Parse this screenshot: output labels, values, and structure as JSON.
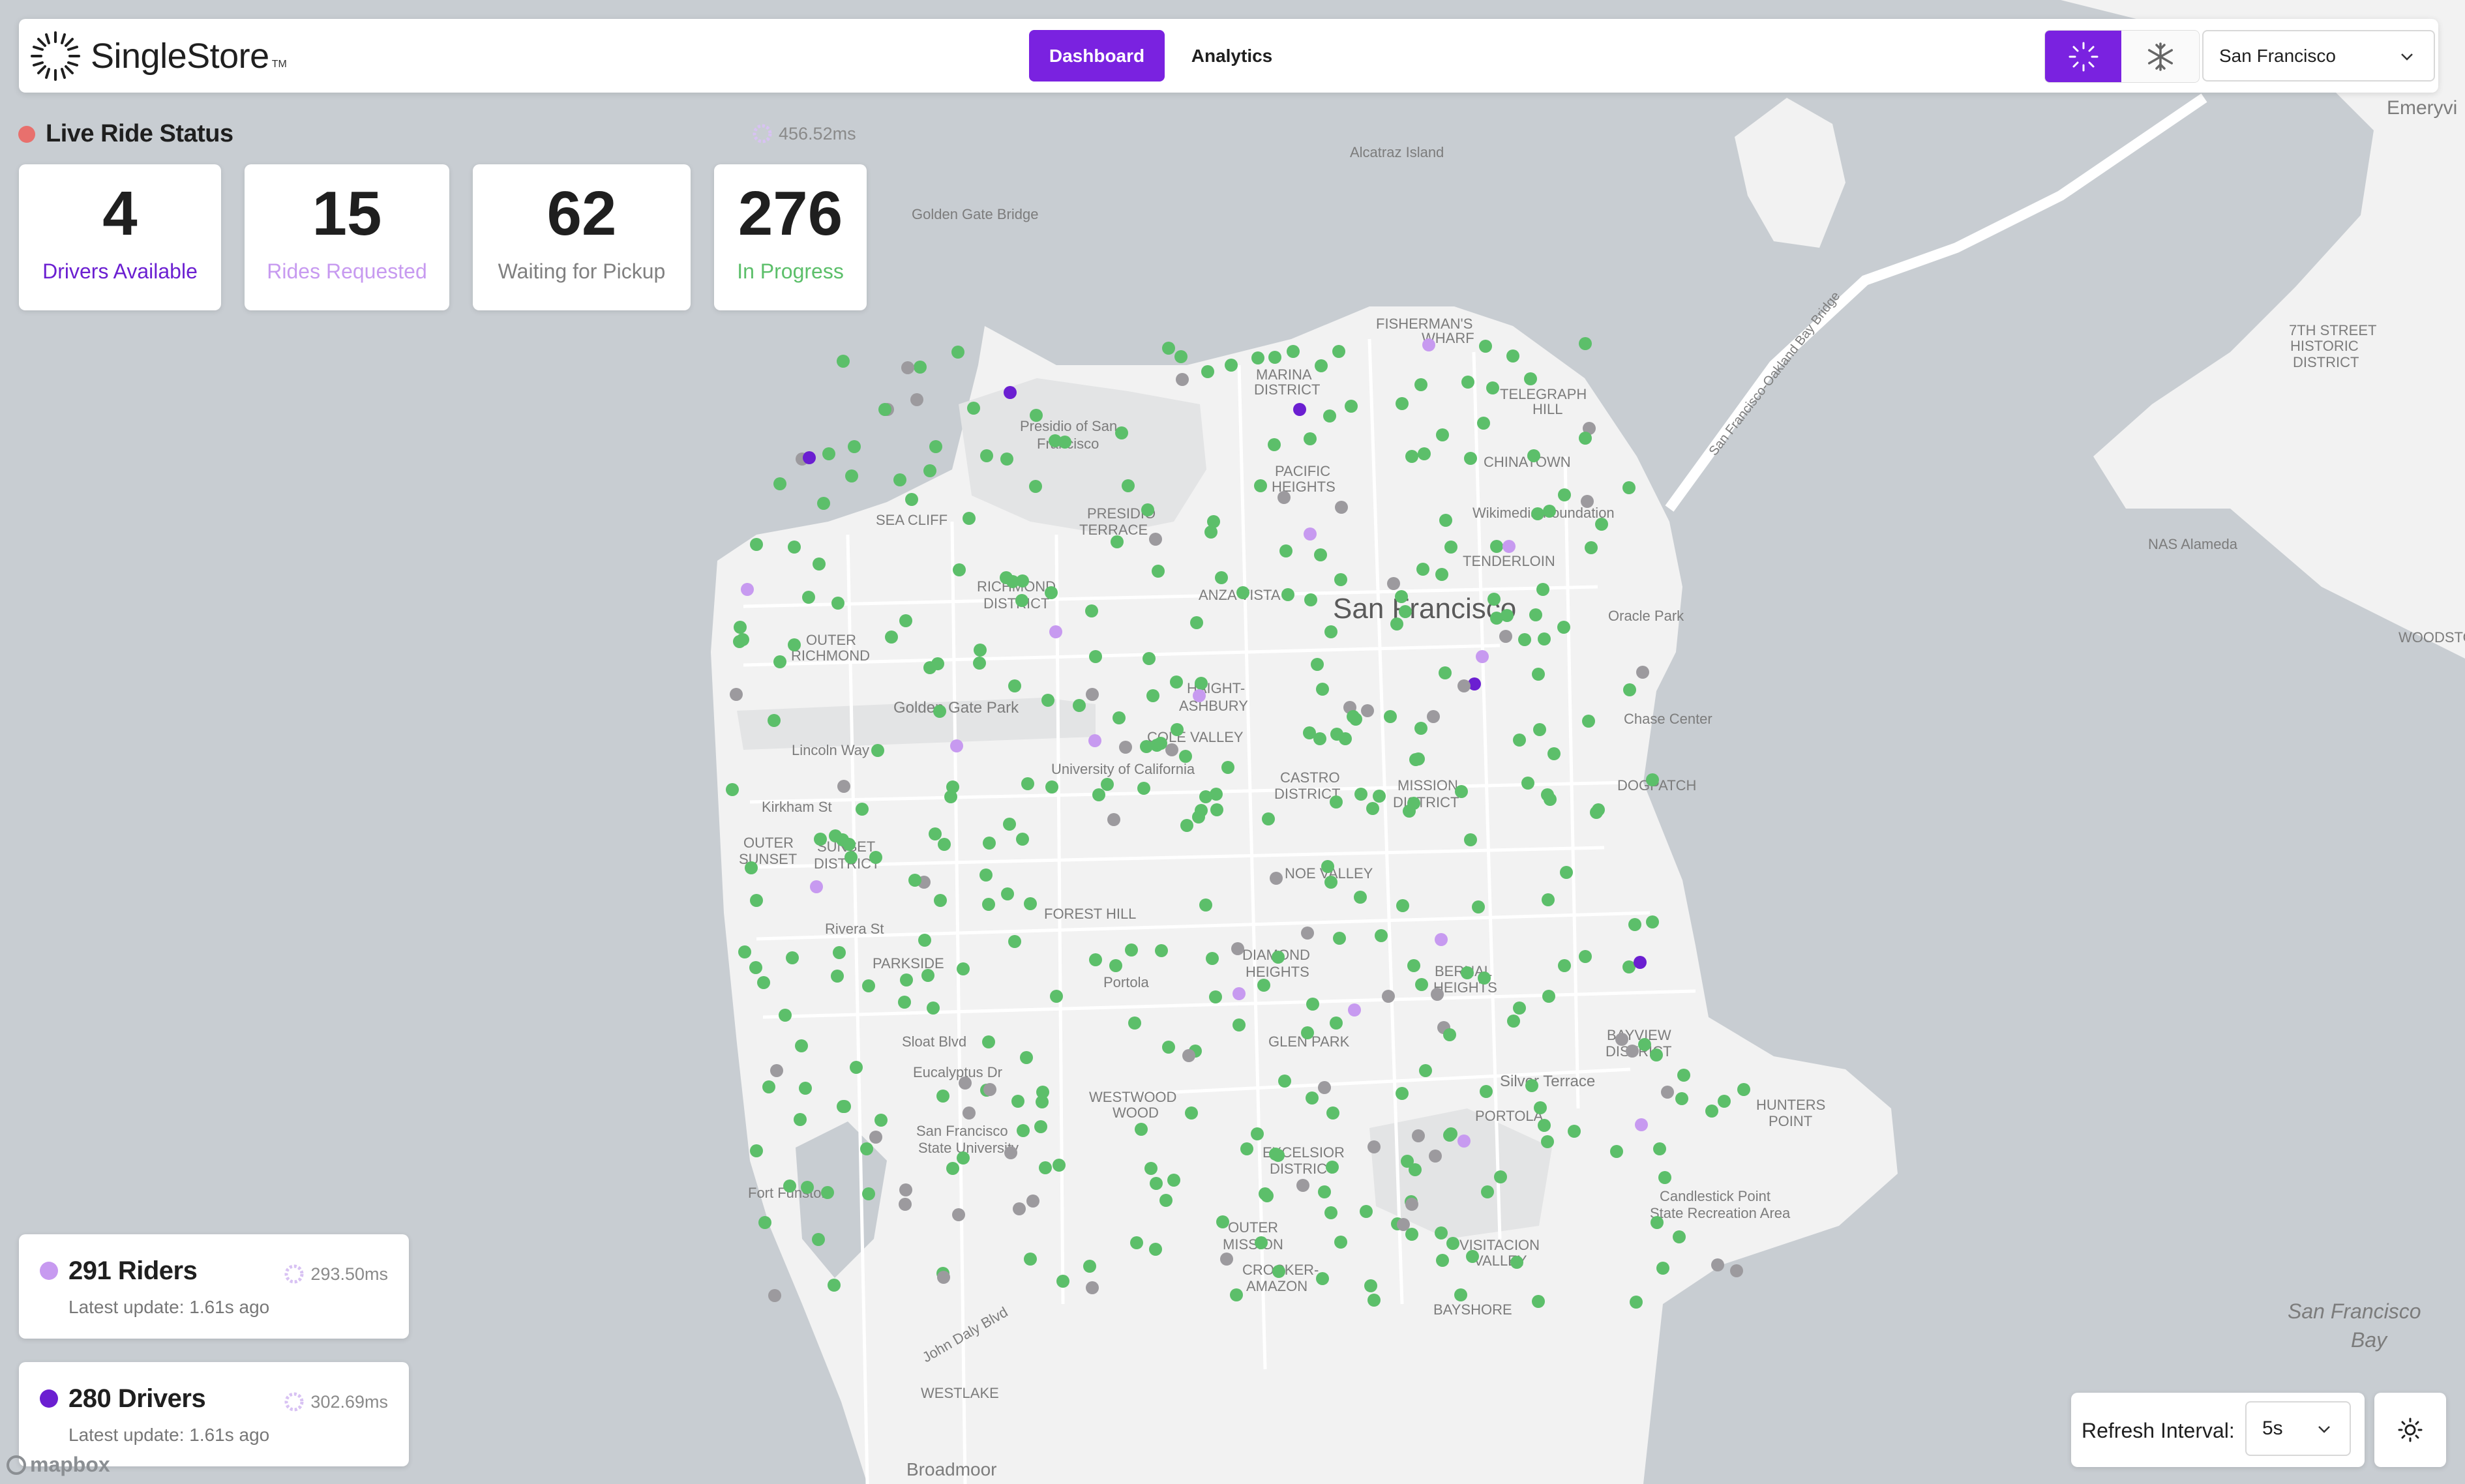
{
  "app": {
    "name": "SingleStore",
    "tm": "TM"
  },
  "nav": {
    "tabs": [
      {
        "label": "Dashboard",
        "active": true
      },
      {
        "label": "Analytics",
        "active": false
      }
    ]
  },
  "connection_toggle": {
    "options": [
      "singlestore-icon",
      "snowflake-icon"
    ],
    "active": 0
  },
  "city_select": {
    "value": "San Francisco"
  },
  "live_status": {
    "title": "Live Ride Status",
    "latency": "456.52ms",
    "stats": [
      {
        "value": "4",
        "label": "Drivers Available",
        "color": "#6b1fd1"
      },
      {
        "value": "15",
        "label": "Rides Requested",
        "color": "#c79af0"
      },
      {
        "value": "62",
        "label": "Waiting for Pickup",
        "color": "#808080"
      },
      {
        "value": "276",
        "label": "In Progress",
        "color": "#5cbf6a"
      }
    ]
  },
  "riders_card": {
    "count": "291 Riders",
    "update": "Latest update: 1.61s ago",
    "latency": "293.50ms",
    "color": "#c79af0"
  },
  "drivers_card": {
    "count": "280 Drivers",
    "update": "Latest update: 1.61s ago",
    "latency": "302.69ms",
    "color": "#6b1fd1"
  },
  "refresh": {
    "label": "Refresh Interval:",
    "value": "5s"
  },
  "map": {
    "attribution": "mapbox",
    "colors": {
      "water": "#c8cdd2",
      "land": "#f2f2f2",
      "park": "#e3e4e5",
      "label": "#7c7c7c"
    },
    "labels": {
      "emeryville": "Emeryvi",
      "alcatraz": "Alcatraz Island",
      "golden_gate_bridge": "Golden Gate Bridge",
      "marina": "MARINA",
      "district": "DISTRICT",
      "fishermans": "FISHERMAN'S",
      "wharf": "WHARF",
      "telegraph": "TELEGRAPH",
      "hill": "HILL",
      "presidio": "Presidio of San",
      "francisco": "Francisco",
      "pacific": "PACIFIC",
      "heights": "HEIGHTS",
      "chinatown": "CHINATOWN",
      "wikimedia": "Wikimedia Foundation",
      "sea_cliff": "SEA CLIFF",
      "presidio_terrace": "PRESIDIO",
      "terrace": "TERRACE",
      "richmond": "RICHMOND",
      "outer": "OUTER",
      "richmond2": "RICHMOND",
      "anza_vista": "ANZA VISTA",
      "tenderloin": "TENDERLOIN",
      "san_francisco": "San Francisco",
      "oracle_park": "Oracle Park",
      "haight": "HAIGHT-",
      "ashbury": "ASHBURY",
      "golden_gate_park": "Golden Gate Park",
      "chase_center": "Chase Center",
      "lincoln_way": "Lincoln Way",
      "cole_valley": "COLE VALLEY",
      "ucsf": "University of California",
      "castro": "CASTRO",
      "mission": "MISSION",
      "dogpatch": "DOGPATCH",
      "kirkham": "Kirkham St",
      "sunset": "SUNSET",
      "outer_sunset": "OUTER",
      "sunset2": "SUNSET",
      "noe_valley": "NOE VALLEY",
      "forest_hill": "FOREST HILL",
      "parkside": "PARKSIDE",
      "rivera": "Rivera St",
      "diamond": "DIAMOND",
      "bernal": "BERNAL",
      "portola_st": "Portola",
      "sloat": "Sloat Blvd",
      "glen_park": "GLEN PARK",
      "bayview": "BAYVIEW",
      "silver_terrace": "Silver Terrace",
      "eucalyptus": "Eucalyptus Dr",
      "westwood": "WESTWOOD",
      "wood": "WOOD",
      "portola": "PORTOLA",
      "hunters": "HUNTERS",
      "point": "POINT",
      "sfsu1": "San Francisco",
      "sfsu2": "State University",
      "fort_funston": "Fort Funston",
      "excelsior": "EXCELSIOR",
      "candlestick1": "Candlestick Point",
      "candlestick2": "State Recreation Area",
      "outer_mission": "OUTER",
      "mission2": "MISSION",
      "crocker": "CROCKER-",
      "amazon": "AMAZON",
      "visitacion": "VISITACION",
      "valley": "VALLEY",
      "bayshore": "BAYSHORE",
      "john_daly": "John Daly Blvd",
      "westlake": "WESTLAKE",
      "broadmoor": "Broadmoor",
      "nas_alameda": "NAS Alameda",
      "sf_bay1": "San Francisco",
      "sf_bay2": "Bay",
      "seventh_street": "7TH STREET",
      "historic": "HISTORIC",
      "district3": "DISTRICT",
      "woodsto": "WOODSTO",
      "bay_bridge": "San Francisco-Oakland Bay Bridge"
    },
    "dot_legend": {
      "driver": "#6b1fd1",
      "rider": "#c79af0",
      "waiting": "#9c9a9e",
      "in_progress": "#5cbf6a"
    }
  }
}
